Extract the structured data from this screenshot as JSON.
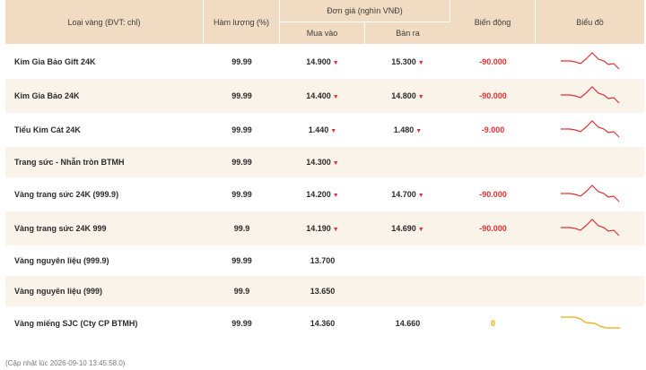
{
  "table": {
    "headers": {
      "type": "Loại vàng (ĐVT: chỉ)",
      "purity": "Hàm lượng (%)",
      "unit_price": "Đơn giá (nghìn VNĐ)",
      "buy": "Mua vào",
      "sell": "Bán ra",
      "change": "Biến động",
      "chart": "Biểu đồ"
    },
    "rows": [
      {
        "name": "Kim Gia Bảo Gift 24K",
        "purity": "99.99",
        "buy": "14.900",
        "buy_down": true,
        "sell": "15.300",
        "sell_down": true,
        "change": "-90.000",
        "change_dir": "down",
        "spark": "down"
      },
      {
        "name": "Kim Gia Bảo 24K",
        "purity": "99.99",
        "buy": "14.400",
        "buy_down": true,
        "sell": "14.800",
        "sell_down": true,
        "change": "-90.000",
        "change_dir": "down",
        "spark": "down"
      },
      {
        "name": "Tiểu Kim Cát 24K",
        "purity": "99.99",
        "buy": "1.440",
        "buy_down": true,
        "sell": "1.480",
        "sell_down": true,
        "change": "-9.000",
        "change_dir": "down",
        "spark": "down"
      },
      {
        "name": "Trang sức - Nhẫn tròn BTMH",
        "purity": "99.99",
        "buy": "14.300",
        "buy_down": true,
        "sell": "",
        "sell_down": false,
        "change": "",
        "change_dir": "none",
        "spark": "none"
      },
      {
        "name": "Vàng trang sức 24K (999.9)",
        "purity": "99.99",
        "buy": "14.200",
        "buy_down": true,
        "sell": "14.700",
        "sell_down": true,
        "change": "-90.000",
        "change_dir": "down",
        "spark": "down"
      },
      {
        "name": "Vàng trang sức 24K 999",
        "purity": "99.9",
        "buy": "14.190",
        "buy_down": true,
        "sell": "14.690",
        "sell_down": true,
        "change": "-90.000",
        "change_dir": "down",
        "spark": "down"
      },
      {
        "name": "Vàng nguyên liệu (999.9)",
        "purity": "99.99",
        "buy": "13.700",
        "buy_down": false,
        "sell": "",
        "sell_down": false,
        "change": "",
        "change_dir": "none",
        "spark": "none"
      },
      {
        "name": "Vàng nguyên liệu (999)",
        "purity": "99.9",
        "buy": "13.650",
        "buy_down": false,
        "sell": "",
        "sell_down": false,
        "change": "",
        "change_dir": "none",
        "spark": "none"
      },
      {
        "name": "Vàng miếng SJC (Cty CP BTMH)",
        "purity": "99.99",
        "buy": "14.360",
        "buy_down": false,
        "sell": "14.660",
        "sell_down": false,
        "change": "0",
        "change_dir": "zero",
        "spark": "flat"
      }
    ]
  },
  "footer": "(Cập nhật lúc 2026-09-10 13:45:58.0)",
  "colors": {
    "header_bg": "#f1dcc3",
    "row_alt_bg": "#faf3ea",
    "down": "#e03131",
    "neutral": "#f2a900"
  },
  "icons": {
    "down_arrow": "▼"
  }
}
